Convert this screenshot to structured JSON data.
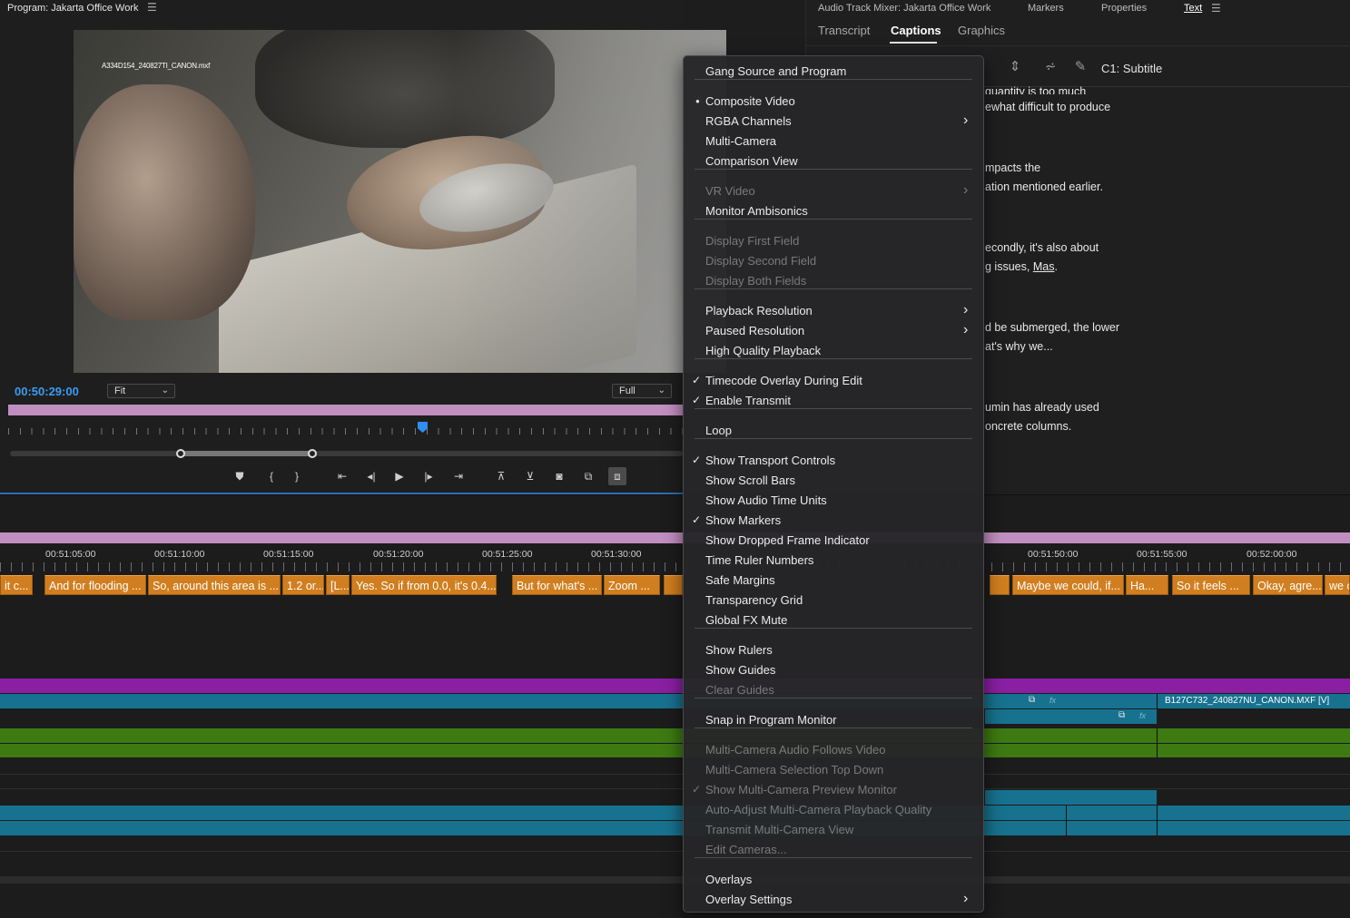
{
  "program": {
    "title": "Program: Jakarta Office Work",
    "clip_overlay_name": "A334D154_240827TI_CANON.mxf",
    "timecode": "00:50:29:00",
    "zoom_select": "Fit",
    "resolution_select": "Full"
  },
  "right_panel": {
    "tabs_top": [
      "Audio Track Mixer: Jakarta Office Work",
      "Markers",
      "Properties",
      "Text"
    ],
    "tabs": [
      "Transcript",
      "Captions",
      "Graphics"
    ],
    "active_tab": "Captions",
    "track_label": "C1: Subtitle",
    "caption_lines": [
      "quantity is too much",
      "ewhat difficult to produce",
      "mpacts the",
      "ation mentioned earlier.",
      "econdly, it's also about",
      "g issues,",
      "Mas",
      ".",
      "d be submerged, the lower",
      "at's why we...",
      "umin has already used",
      "oncrete columns."
    ]
  },
  "timeline": {
    "timecodes": [
      "00:51:05:00",
      "00:51:10:00",
      "00:51:15:00",
      "00:51:20:00",
      "00:51:25:00",
      "00:51:30:00",
      "00:51:50:00",
      "00:51:55:00",
      "00:52:00:00"
    ],
    "caption_clips": [
      "it c...",
      "And for flooding ...",
      "So, around this area is ...",
      "1.2 or...",
      "[L...",
      "Yes. So if from 0.0, it's 0.4...",
      "But for what's ...",
      "Zoom ...",
      "Maybe we could, if...",
      "Ha...",
      "So it feels ...",
      "Okay, agre...",
      "we c"
    ],
    "video_clip_name": "B127C732_240827NU_CANON.MXF [V]",
    "fx_label": "fx"
  },
  "context_menu": {
    "items": [
      {
        "label": "Gang Source and Program",
        "checked": false,
        "disabled": false,
        "submenu": false
      },
      {
        "label": "Composite Video",
        "checked": "dot",
        "disabled": false,
        "submenu": false
      },
      {
        "label": "RGBA Channels",
        "checked": false,
        "disabled": false,
        "submenu": true
      },
      {
        "label": "Multi-Camera",
        "checked": false,
        "disabled": false,
        "submenu": false
      },
      {
        "label": "Comparison View",
        "checked": false,
        "disabled": false,
        "submenu": false
      },
      {
        "label": "VR Video",
        "checked": false,
        "disabled": true,
        "submenu": true
      },
      {
        "label": "Monitor Ambisonics",
        "checked": false,
        "disabled": false,
        "submenu": false
      },
      {
        "label": "Display First Field",
        "checked": false,
        "disabled": true,
        "submenu": false
      },
      {
        "label": "Display Second Field",
        "checked": false,
        "disabled": true,
        "submenu": false
      },
      {
        "label": "Display Both Fields",
        "checked": false,
        "disabled": true,
        "submenu": false
      },
      {
        "label": "Playback Resolution",
        "checked": false,
        "disabled": false,
        "submenu": true
      },
      {
        "label": "Paused Resolution",
        "checked": false,
        "disabled": false,
        "submenu": true
      },
      {
        "label": "High Quality Playback",
        "checked": false,
        "disabled": false,
        "submenu": false
      },
      {
        "label": "Timecode Overlay During Edit",
        "checked": true,
        "disabled": false,
        "submenu": false
      },
      {
        "label": "Enable Transmit",
        "checked": true,
        "disabled": false,
        "submenu": false
      },
      {
        "label": "Loop",
        "checked": false,
        "disabled": false,
        "submenu": false
      },
      {
        "label": "Show Transport Controls",
        "checked": true,
        "disabled": false,
        "submenu": false
      },
      {
        "label": "Show Scroll Bars",
        "checked": false,
        "disabled": false,
        "submenu": false
      },
      {
        "label": "Show Audio Time Units",
        "checked": false,
        "disabled": false,
        "submenu": false
      },
      {
        "label": "Show Markers",
        "checked": true,
        "disabled": false,
        "submenu": false
      },
      {
        "label": "Show Dropped Frame Indicator",
        "checked": false,
        "disabled": false,
        "submenu": false
      },
      {
        "label": "Time Ruler Numbers",
        "checked": false,
        "disabled": false,
        "submenu": false
      },
      {
        "label": "Safe Margins",
        "checked": false,
        "disabled": false,
        "submenu": false
      },
      {
        "label": "Transparency Grid",
        "checked": false,
        "disabled": false,
        "submenu": false
      },
      {
        "label": "Global FX Mute",
        "checked": false,
        "disabled": false,
        "submenu": false
      },
      {
        "label": "Show Rulers",
        "checked": false,
        "disabled": false,
        "submenu": false
      },
      {
        "label": "Show Guides",
        "checked": false,
        "disabled": false,
        "submenu": false
      },
      {
        "label": "Clear Guides",
        "checked": false,
        "disabled": true,
        "submenu": false
      },
      {
        "label": "Snap in Program Monitor",
        "checked": false,
        "disabled": false,
        "submenu": false
      },
      {
        "label": "Multi-Camera Audio Follows Video",
        "checked": false,
        "disabled": true,
        "submenu": false
      },
      {
        "label": "Multi-Camera Selection Top Down",
        "checked": false,
        "disabled": true,
        "submenu": false
      },
      {
        "label": "Show Multi-Camera Preview Monitor",
        "checked": true,
        "disabled": true,
        "submenu": false
      },
      {
        "label": "Auto-Adjust Multi-Camera Playback Quality",
        "checked": false,
        "disabled": true,
        "submenu": false
      },
      {
        "label": "Transmit Multi-Camera View",
        "checked": false,
        "disabled": true,
        "submenu": false
      },
      {
        "label": "Edit Cameras...",
        "checked": false,
        "disabled": true,
        "submenu": false
      },
      {
        "label": "Overlays",
        "checked": false,
        "disabled": false,
        "submenu": false
      },
      {
        "label": "Overlay Settings",
        "checked": false,
        "disabled": false,
        "submenu": true
      }
    ]
  },
  "icons": {
    "panel_menu": "hamburger-icon",
    "chevron": "chevron-down-icon",
    "submenu": "chevron-right-icon",
    "check": "checkmark-icon"
  },
  "colors": {
    "timecode": "#3b9cf2",
    "work_area": "#c18ec0",
    "caption_clip": "#d07e1f",
    "video_track": "#17728f",
    "audio_track": "#3d7a12",
    "graphic_track": "#8a1fa3"
  }
}
